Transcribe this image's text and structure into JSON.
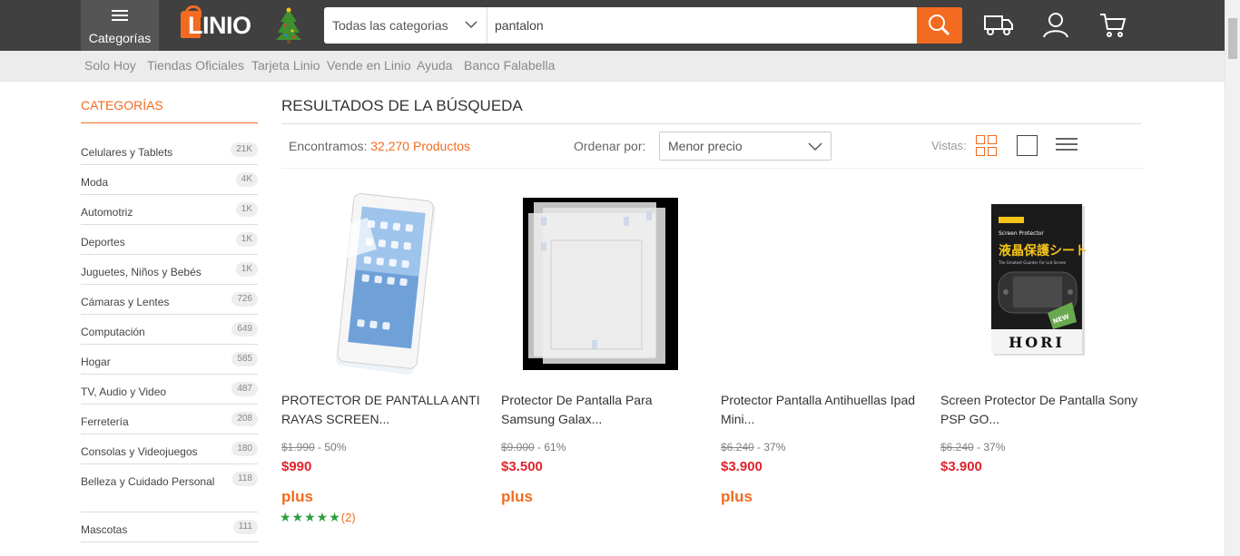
{
  "header": {
    "categories_label": "Categorías",
    "logo_text": "LINIO",
    "search_category": "Todas las categorias",
    "search_value": "pantalon"
  },
  "subnav": [
    "Solo Hoy",
    "Tiendas Oficiales",
    "Tarjeta Linio",
    "Vende en Linio",
    "Ayuda",
    "Banco Falabella"
  ],
  "sidebar": {
    "title": "CATEGORÍAS",
    "items": [
      {
        "label": "Celulares y Tablets",
        "count": "21K"
      },
      {
        "label": "Moda",
        "count": "4K"
      },
      {
        "label": "Automotriz",
        "count": "1K"
      },
      {
        "label": "Deportes",
        "count": "1K"
      },
      {
        "label": "Juguetes, Niños y Bebés",
        "count": "1K"
      },
      {
        "label": "Cámaras y Lentes",
        "count": "726"
      },
      {
        "label": "Computación",
        "count": "649"
      },
      {
        "label": "Hogar",
        "count": "585"
      },
      {
        "label": "TV, Audio y Video",
        "count": "487"
      },
      {
        "label": "Ferretería",
        "count": "208"
      },
      {
        "label": "Consolas y Videojuegos",
        "count": "180"
      },
      {
        "label": "Belleza y Cuidado Personal",
        "count": "118"
      },
      {
        "label": "Mascotas",
        "count": "111"
      }
    ]
  },
  "results": {
    "title": "RESULTADOS DE LA BÚSQUEDA",
    "found_prefix": "Encontramos:",
    "found_count": "32,270 Productos",
    "order_label": "Ordenar por:",
    "order_value": "Menor precio",
    "views_label": "Vistas:"
  },
  "products": [
    {
      "name": "PROTECTOR DE PANTALLA ANTI RAYAS SCREEN...",
      "old_price": "$1.990",
      "discount": "- 50%",
      "price": "$990",
      "plus": "plus",
      "stars": "★★★★★",
      "reviews": "(2)"
    },
    {
      "name": "Protector De Pantalla Para Samsung Galax...",
      "old_price": "$9.000",
      "discount": "- 61%",
      "price": "$3.500",
      "plus": "plus"
    },
    {
      "name": "Protector Pantalla Antihuellas Ipad Mini...",
      "old_price": "$6.240",
      "discount": "- 37%",
      "price": "$3.900",
      "plus": "plus"
    },
    {
      "name": "Screen Protector De Pantalla Sony PSP GO...",
      "old_price": "$6.240",
      "discount": "- 37%",
      "price": "$3.900"
    }
  ],
  "product4_box": {
    "top_text": "Screen Protector",
    "jp_text": "液晶保護シート",
    "sub_text": "The Greatest Guarder For Lcd Screen",
    "brand": "HORI",
    "badge": "NEW"
  },
  "colors": {
    "accent": "#f26b21",
    "price": "#e0232d",
    "header": "#404040",
    "rating": "#2e9e3e"
  }
}
